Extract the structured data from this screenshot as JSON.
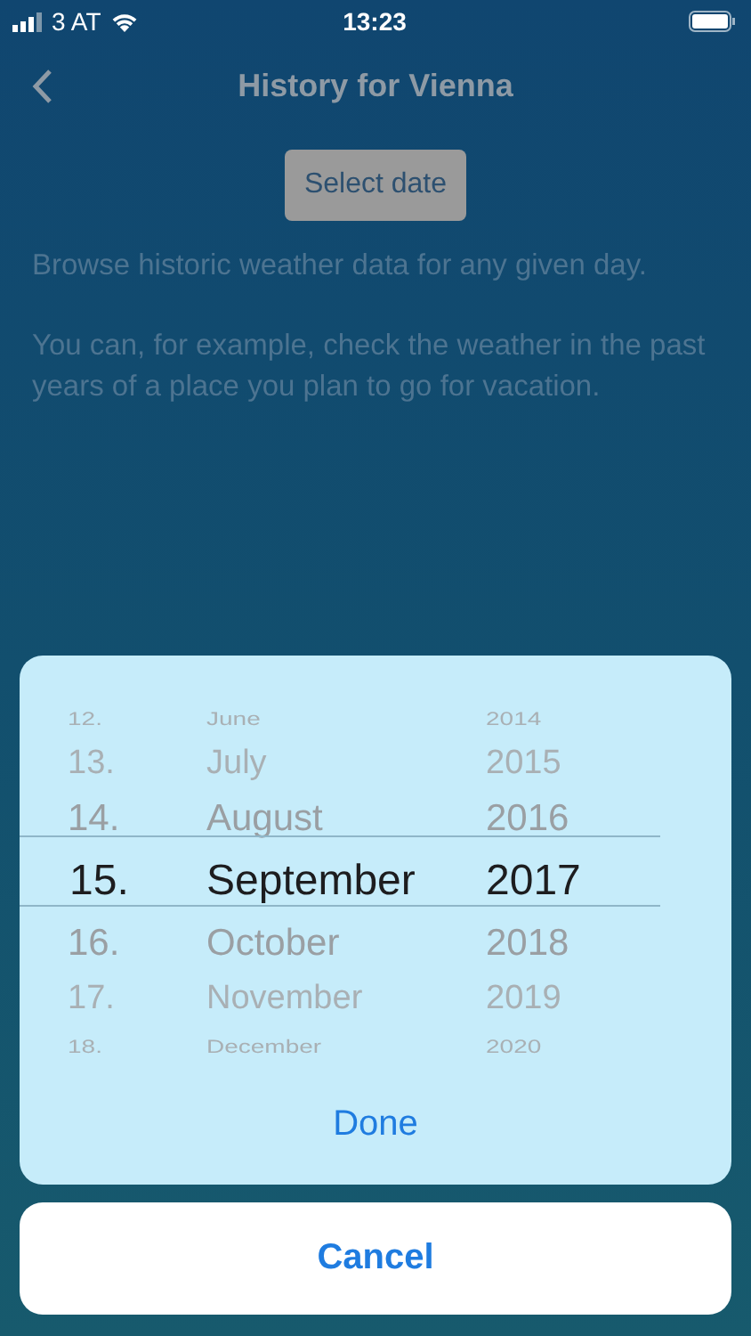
{
  "status_bar": {
    "carrier": "3 AT",
    "time": "13:23"
  },
  "nav": {
    "title": "History for Vienna"
  },
  "select_button": "Select date",
  "description": [
    "Browse historic weather data for any given day.",
    "You can, for example, check the weather in the past years of a place you plan to go for vacation."
  ],
  "picker": {
    "rows": [
      {
        "day": "12.",
        "month": "June",
        "year": "2014",
        "selected": false
      },
      {
        "day": "13.",
        "month": "July",
        "year": "2015",
        "selected": false
      },
      {
        "day": "14.",
        "month": "August",
        "year": "2016",
        "selected": false
      },
      {
        "day": "15.",
        "month": "September",
        "year": "2017",
        "selected": true
      },
      {
        "day": "16.",
        "month": "October",
        "year": "2018",
        "selected": false
      },
      {
        "day": "17.",
        "month": "November",
        "year": "2019",
        "selected": false
      },
      {
        "day": "18.",
        "month": "December",
        "year": "2020",
        "selected": false
      }
    ],
    "done": "Done"
  },
  "cancel": "Cancel"
}
